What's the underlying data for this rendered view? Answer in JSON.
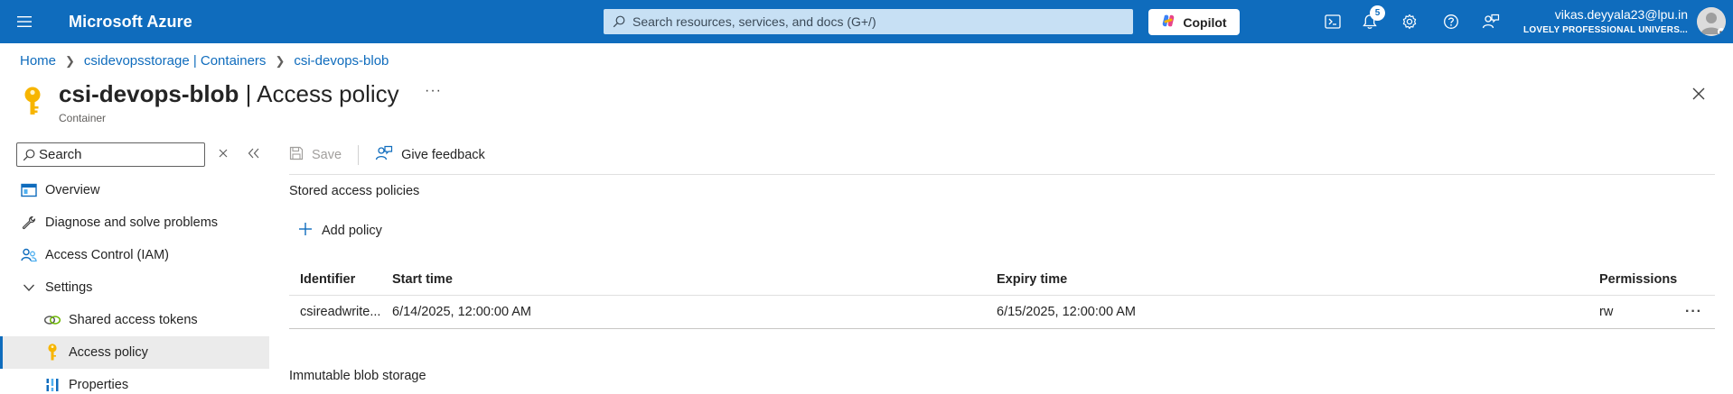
{
  "topbar": {
    "brand": "Microsoft Azure",
    "search_placeholder": "Search resources, services, and docs (G+/)",
    "copilot_label": "Copilot",
    "notification_count": "5",
    "account_email": "vikas.deyyala23@lpu.in",
    "account_tenant": "LOVELY PROFESSIONAL UNIVERS...",
    "brand_color": "#0f6cbd",
    "icons": [
      "menu-icon",
      "search-icon",
      "copilot-icon",
      "cloud-shell-icon",
      "bell-icon",
      "settings-icon",
      "help-icon",
      "feedback-icon",
      "avatar"
    ]
  },
  "breadcrumb": {
    "items": [
      "Home",
      "csidevopsstorage | Containers",
      "csi-devops-blob"
    ]
  },
  "header": {
    "resource_name": "csi-devops-blob",
    "separator": " | ",
    "page_name": "Access policy",
    "subtitle": "Container",
    "more": "···"
  },
  "sidebar": {
    "search_placeholder": "Search",
    "items": [
      {
        "label": "Overview",
        "icon": "overview-icon"
      },
      {
        "label": "Diagnose and solve problems",
        "icon": "wrench-icon"
      },
      {
        "label": "Access Control (IAM)",
        "icon": "people-icon"
      },
      {
        "label": "Settings",
        "icon": "chevron-down-icon"
      },
      {
        "label": "Shared access tokens",
        "icon": "link-icon"
      },
      {
        "label": "Access policy",
        "icon": "key-icon",
        "active": true
      },
      {
        "label": "Properties",
        "icon": "properties-icon"
      }
    ]
  },
  "commandbar": {
    "save_label": "Save",
    "feedback_label": "Give feedback"
  },
  "stored_policies": {
    "title": "Stored access policies",
    "add_label": "Add policy",
    "columns": [
      "Identifier",
      "Start time",
      "Expiry time",
      "Permissions"
    ],
    "rows": [
      {
        "identifier": "csireadwrite...",
        "start": "6/14/2025, 12:00:00 AM",
        "expiry": "6/15/2025, 12:00:00 AM",
        "permissions": "rw",
        "more": "···"
      }
    ]
  },
  "immutable": {
    "title": "Immutable blob storage"
  }
}
